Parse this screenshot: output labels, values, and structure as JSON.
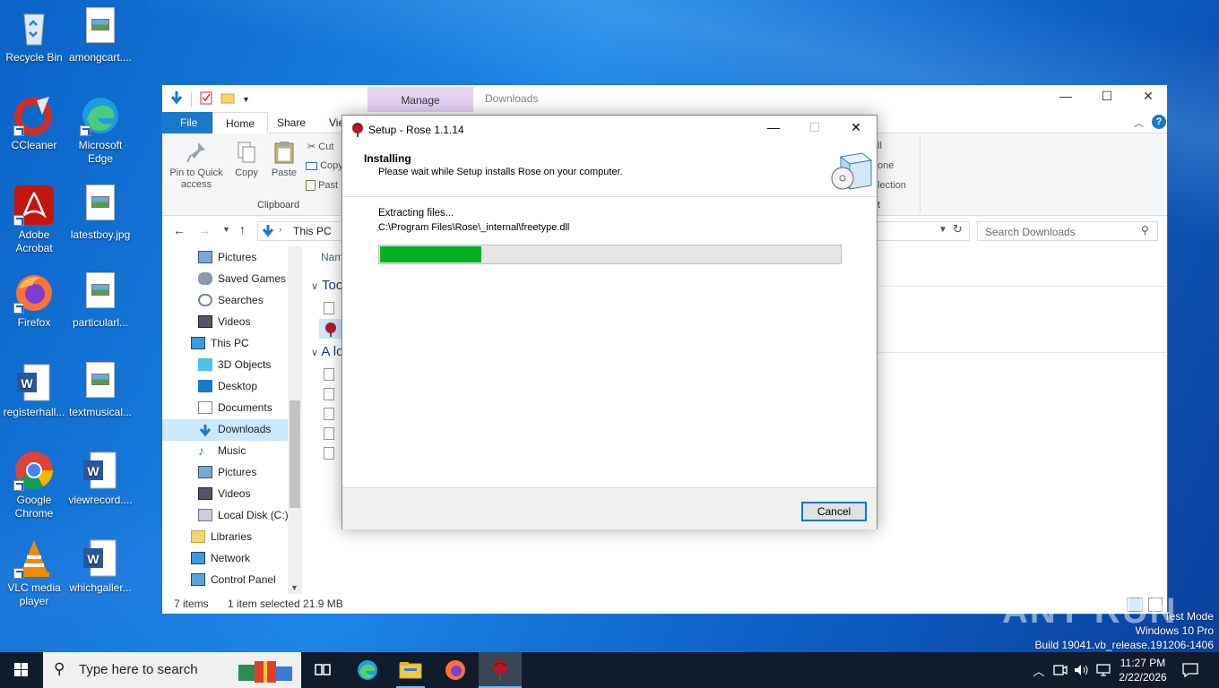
{
  "desktop_icons": [
    {
      "label": "Recycle Bin",
      "icon": "recycle-bin-icon"
    },
    {
      "label": "amongcart....",
      "icon": "image-file-icon"
    },
    {
      "label": "CCleaner",
      "icon": "ccleaner-icon"
    },
    {
      "label": "Microsoft Edge",
      "icon": "edge-icon"
    },
    {
      "label": "Adobe Acrobat",
      "icon": "acrobat-icon"
    },
    {
      "label": "latestboy.jpg",
      "icon": "image-file-icon"
    },
    {
      "label": "Firefox",
      "icon": "firefox-icon"
    },
    {
      "label": "particularl...",
      "icon": "image-file-icon"
    },
    {
      "label": "registerhall...",
      "icon": "word-icon"
    },
    {
      "label": "textmusical...",
      "icon": "image-file-icon"
    },
    {
      "label": "Google Chrome",
      "icon": "chrome-icon"
    },
    {
      "label": "viewrecord....",
      "icon": "word-icon"
    },
    {
      "label": "VLC media player",
      "icon": "vlc-icon"
    },
    {
      "label": "whichgaller...",
      "icon": "word-icon"
    }
  ],
  "explorer": {
    "manage_tab": "Manage",
    "title": "Downloads",
    "tabs": {
      "file": "File",
      "home": "Home",
      "share": "Share",
      "view": "Vie"
    },
    "ribbon": {
      "pin": "Pin to Quick access",
      "copy": "Copy",
      "paste": "Paste",
      "cut": "Cut",
      "copy_path": "Copy",
      "paste_shortcut": "Past",
      "group_clipboard": "Clipboard",
      "right_1": "ll",
      "right_2": "one",
      "right_3": "election",
      "right_4": "t"
    },
    "address": {
      "this_pc": "This PC"
    },
    "search_placeholder": "Search Downloads",
    "nav": [
      {
        "label": "Pictures",
        "icon": "pictures-icon"
      },
      {
        "label": "Saved Games",
        "icon": "saved-games-icon"
      },
      {
        "label": "Searches",
        "icon": "searches-icon"
      },
      {
        "label": "Videos",
        "icon": "videos-icon"
      },
      {
        "label": "This PC",
        "icon": "this-pc-icon"
      },
      {
        "label": "3D Objects",
        "icon": "3d-objects-icon"
      },
      {
        "label": "Desktop",
        "icon": "desktop-icon"
      },
      {
        "label": "Documents",
        "icon": "documents-icon"
      },
      {
        "label": "Downloads",
        "icon": "downloads-icon"
      },
      {
        "label": "Music",
        "icon": "music-icon"
      },
      {
        "label": "Pictures",
        "icon": "pictures-icon"
      },
      {
        "label": "Videos",
        "icon": "videos-icon"
      },
      {
        "label": "Local Disk (C:)",
        "icon": "local-disk-icon"
      },
      {
        "label": "Libraries",
        "icon": "libraries-icon"
      },
      {
        "label": "Network",
        "icon": "network-icon"
      },
      {
        "label": "Control Panel",
        "icon": "control-panel-icon"
      }
    ],
    "content": {
      "col_name": "Nam",
      "group_today": "Too",
      "group_later": "A lo"
    },
    "status": {
      "items": "7 items",
      "selected": "1 item selected  21.9 MB"
    }
  },
  "dialog": {
    "title": "Setup - Rose 1.1.14",
    "heading": "Installing",
    "subheading": "Please wait while Setup installs Rose on your computer.",
    "status": "Extracting files...",
    "file": "C:\\Program Files\\Rose\\_internal\\freetype.dll",
    "progress": 0.22,
    "cancel": "Cancel"
  },
  "watermark": {
    "line1": "Test Mode",
    "line2": "Windows 10 Pro",
    "line3": "Build 19041.vb_release.191206-1406",
    "brand": "ANY RUN"
  },
  "taskbar": {
    "search_placeholder": "Type here to search",
    "time": "11:27 PM",
    "date": "2/22/2026"
  },
  "colors": {
    "accent": "#1979ca",
    "progress": "#06b025",
    "taskbar": "#101c2c"
  }
}
